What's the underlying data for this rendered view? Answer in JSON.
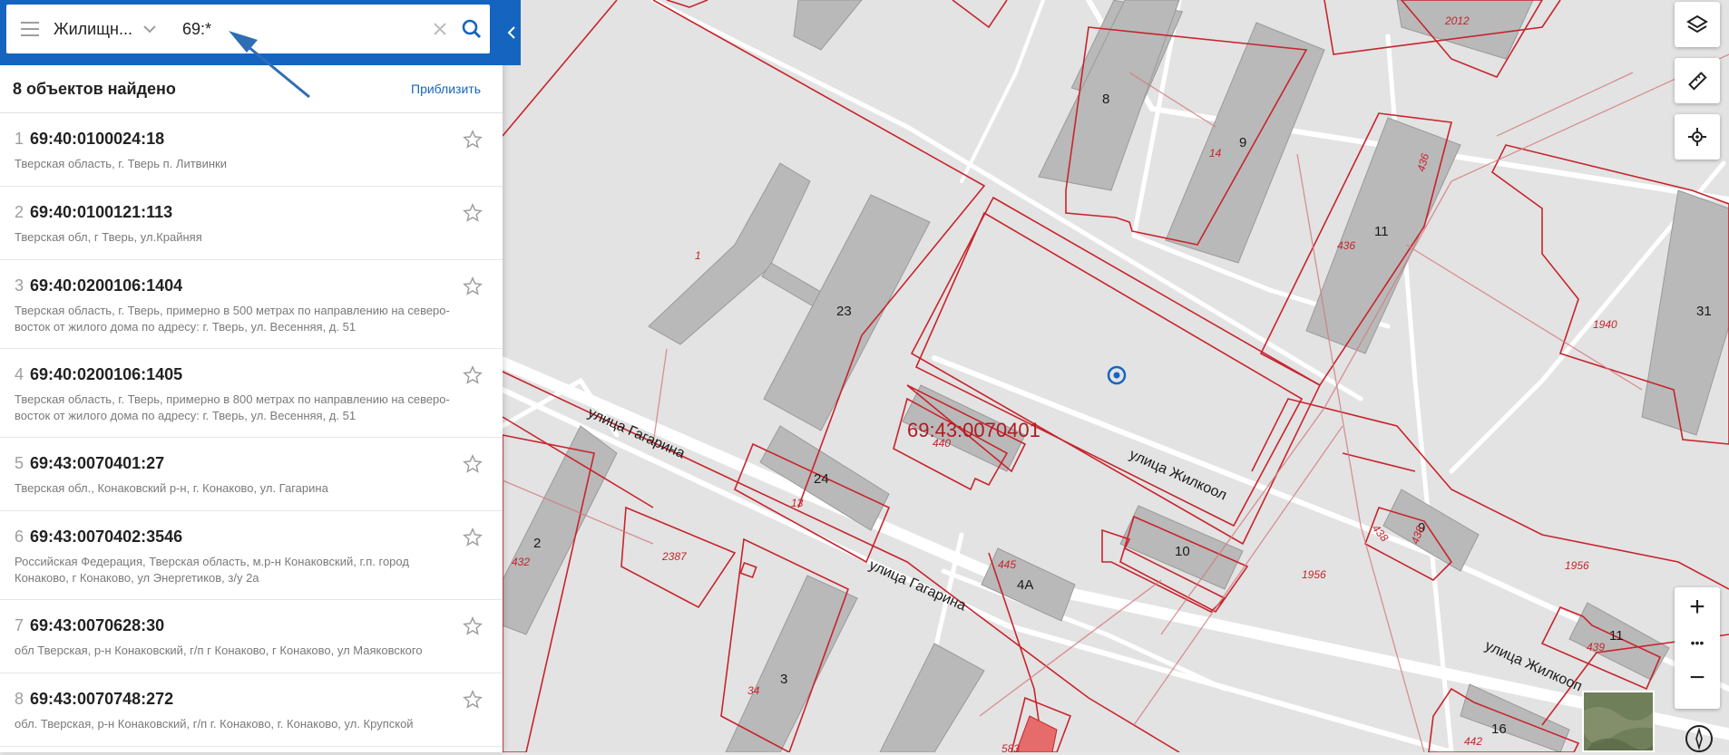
{
  "search": {
    "filter_label": "Жилищн...",
    "query": "69:*",
    "clear_icon": "close-icon",
    "search_icon": "search-icon",
    "menu_icon": "hamburger-icon",
    "accent": "#1565c0"
  },
  "results_header": {
    "count_text": "8 объектов найдено",
    "zoom_link": "Приблизить"
  },
  "results": [
    {
      "num": "1",
      "cad": "69:40:0100024:18",
      "addr": "Тверская область, г. Тверь п. Литвинки"
    },
    {
      "num": "2",
      "cad": "69:40:0100121:113",
      "addr": "Тверская обл, г Тверь, ул.Крайняя"
    },
    {
      "num": "3",
      "cad": "69:40:0200106:1404",
      "addr": "Тверская область, г. Тверь, примерно в 500 метрах по направлению на северо-восток от жилого дома по адресу: г. Тверь, ул. Весенняя, д. 51"
    },
    {
      "num": "4",
      "cad": "69:40:0200106:1405",
      "addr": "Тверская область, г. Тверь, примерно в 800 метрах по направлению на северо-восток от жилого дома по адресу: г. Тверь, ул. Весенняя, д. 51"
    },
    {
      "num": "5",
      "cad": "69:43:0070401:27",
      "addr": "Тверская обл., Конаковский р-н, г. Конаково, ул. Гагарина"
    },
    {
      "num": "6",
      "cad": "69:43:0070402:3546",
      "addr": "Российская Федерация, Тверская область, м.р-н Конаковский, г.п. город Конаково, г Конаково, ул Энергетиков, з/у 2а"
    },
    {
      "num": "7",
      "cad": "69:43:0070628:30",
      "addr": "обл Тверская, р-н Конаковский, г/п г Конаково, г Конаково, ул Маяковского"
    },
    {
      "num": "8",
      "cad": "69:43:0070748:272",
      "addr": "обл. Тверская, р-н Конаковский, г/п г. Конаково, г. Конаково, ул. Крупской"
    }
  ],
  "map": {
    "quarter_label": "69:43:0070401",
    "streets": [
      "улица Гагарина",
      "улица Гагарина",
      "улица Жилкоол",
      "улица Жилкооп"
    ],
    "building_numbers": [
      "8",
      "9",
      "11",
      "23",
      "24",
      "2",
      "3",
      "10",
      "4А",
      "9",
      "11",
      "16",
      "31",
      "1"
    ],
    "parcel_numbers": [
      "2012",
      "14",
      "436",
      "436",
      "1940",
      "440",
      "13",
      "432",
      "2387",
      "445",
      "1956",
      "438",
      "438",
      "1956",
      "439",
      "34",
      "583",
      "442",
      "1"
    ]
  },
  "controls": {
    "layers_icon": "layers-icon",
    "ruler_icon": "ruler-icon",
    "locate_icon": "crosshair-icon",
    "zoom_in": "+",
    "more": "•••",
    "zoom_out": "−",
    "compass_icon": "compass-icon"
  }
}
